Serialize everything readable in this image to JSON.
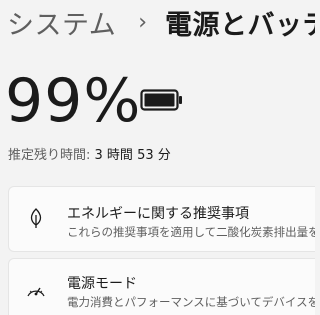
{
  "breadcrumb": {
    "parent": "システム",
    "separator": "›",
    "current": "電源とバッテリー"
  },
  "battery": {
    "percent_text": "99%",
    "icon": "battery-icon",
    "remaining_label": "推定残り時間:",
    "remaining_value": "3 時間 53 分"
  },
  "cards": [
    {
      "icon": "leaf-icon",
      "title": "エネルギーに関する推奨事項",
      "subtitle": "これらの推奨事項を適用して二酸化炭素排出量を削減"
    },
    {
      "icon": "power-mode-icon",
      "title": "電源モード",
      "subtitle": "電力消費とパフォーマンスに基づいてデバイスを最適化"
    }
  ],
  "colors": {
    "background": "#f3f3f3",
    "card": "#fbfbfb",
    "text_primary": "#1b1b1b",
    "text_secondary": "#5f5f5f"
  }
}
